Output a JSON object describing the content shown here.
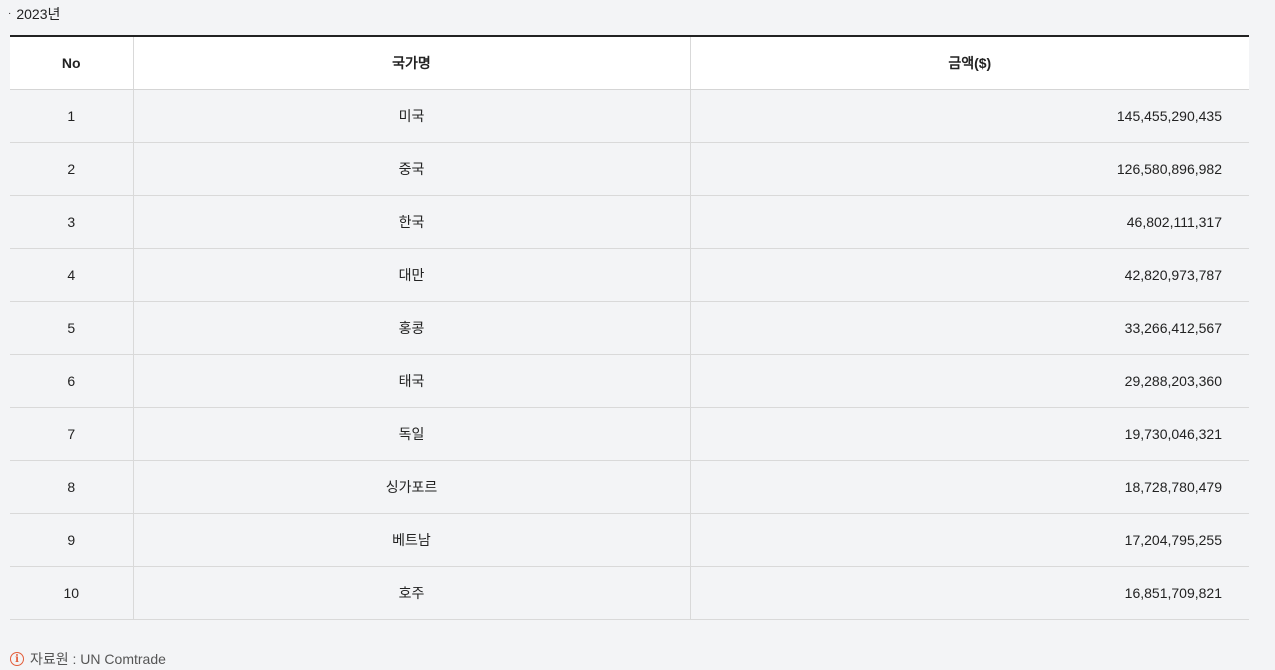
{
  "year_label": "2023년",
  "table": {
    "headers": [
      "No",
      "국가명",
      "금액($)"
    ],
    "rows": [
      {
        "no": "1",
        "country": "미국",
        "amount": "145,455,290,435"
      },
      {
        "no": "2",
        "country": "중국",
        "amount": "126,580,896,982"
      },
      {
        "no": "3",
        "country": "한국",
        "amount": "46,802,111,317"
      },
      {
        "no": "4",
        "country": "대만",
        "amount": "42,820,973,787"
      },
      {
        "no": "5",
        "country": "홍콩",
        "amount": "33,266,412,567"
      },
      {
        "no": "6",
        "country": "태국",
        "amount": "29,288,203,360"
      },
      {
        "no": "7",
        "country": "독일",
        "amount": "19,730,046,321"
      },
      {
        "no": "8",
        "country": "싱가포르",
        "amount": "18,728,780,479"
      },
      {
        "no": "9",
        "country": "베트남",
        "amount": "17,204,795,255"
      },
      {
        "no": "10",
        "country": "호주",
        "amount": "16,851,709,821"
      }
    ]
  },
  "source": {
    "icon": "info-icon",
    "text": "자료원 : UN Comtrade",
    "icon_color": "#e35d3a"
  }
}
